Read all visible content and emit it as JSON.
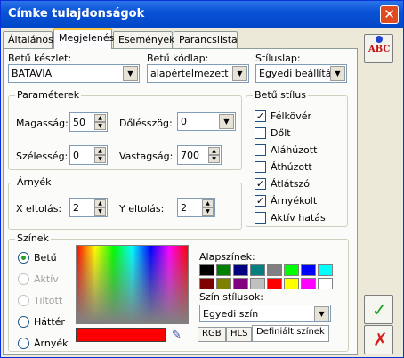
{
  "window": {
    "title": "Címke tulajdonságok"
  },
  "tabs": [
    "Általános",
    "Megjelenés",
    "Események",
    "Parancslista"
  ],
  "font": {
    "font_label": "Betű készlet:",
    "font_value": "BATAVIA",
    "codepage_label": "Betű kódlap:",
    "codepage_value": "alapértelmezett",
    "style_label": "Stíluslap:",
    "style_value": "Egyedi beállítás"
  },
  "params": {
    "title": "Paraméterek",
    "height_label": "Magasság:",
    "height_value": "50",
    "angle_label": "Dőlésszög:",
    "angle_value": "0",
    "width_label": "Szélesség:",
    "width_value": "0",
    "thickness_label": "Vastagság:",
    "thickness_value": "700"
  },
  "fontstyle": {
    "title": "Betű stílus",
    "items": [
      {
        "label": "Félkövér",
        "checked": true
      },
      {
        "label": "Dőlt",
        "checked": false
      },
      {
        "label": "Aláhúzott",
        "checked": false
      },
      {
        "label": "Áthúzott",
        "checked": false
      },
      {
        "label": "Átlátszó",
        "checked": true
      },
      {
        "label": "Árnyékolt",
        "checked": true
      },
      {
        "label": "Aktív hatás",
        "checked": false
      }
    ]
  },
  "shadow": {
    "title": "Árnyék",
    "x_label": "X eltolás:",
    "x_value": "2",
    "y_label": "Y eltolás:",
    "y_value": "2"
  },
  "colors": {
    "title": "Színek",
    "options": [
      {
        "label": "Betű",
        "selected": true,
        "disabled": false
      },
      {
        "label": "Aktív",
        "selected": false,
        "disabled": true
      },
      {
        "label": "Tiltott",
        "selected": false,
        "disabled": true
      },
      {
        "label": "Háttér",
        "selected": false,
        "disabled": false
      },
      {
        "label": "Árnyék",
        "selected": false,
        "disabled": false
      }
    ],
    "base_label": "Alapszínek:",
    "swatches": [
      "#000000",
      "#008000",
      "#000080",
      "#008080",
      "#808080",
      "#00ff00",
      "#0000ff",
      "#00ffff",
      "#800000",
      "#808000",
      "#800080",
      "#c0c0c0",
      "#ff0000",
      "#ffff00",
      "#ff00ff",
      "#ffffff"
    ],
    "current_color": "#ff0000",
    "style_label": "Szín stílusok:",
    "style_value": "Egyedi szín",
    "subtabs": [
      "RGB",
      "HLS",
      "Definiált színek"
    ]
  },
  "side": {
    "abc_label": "ABC"
  }
}
